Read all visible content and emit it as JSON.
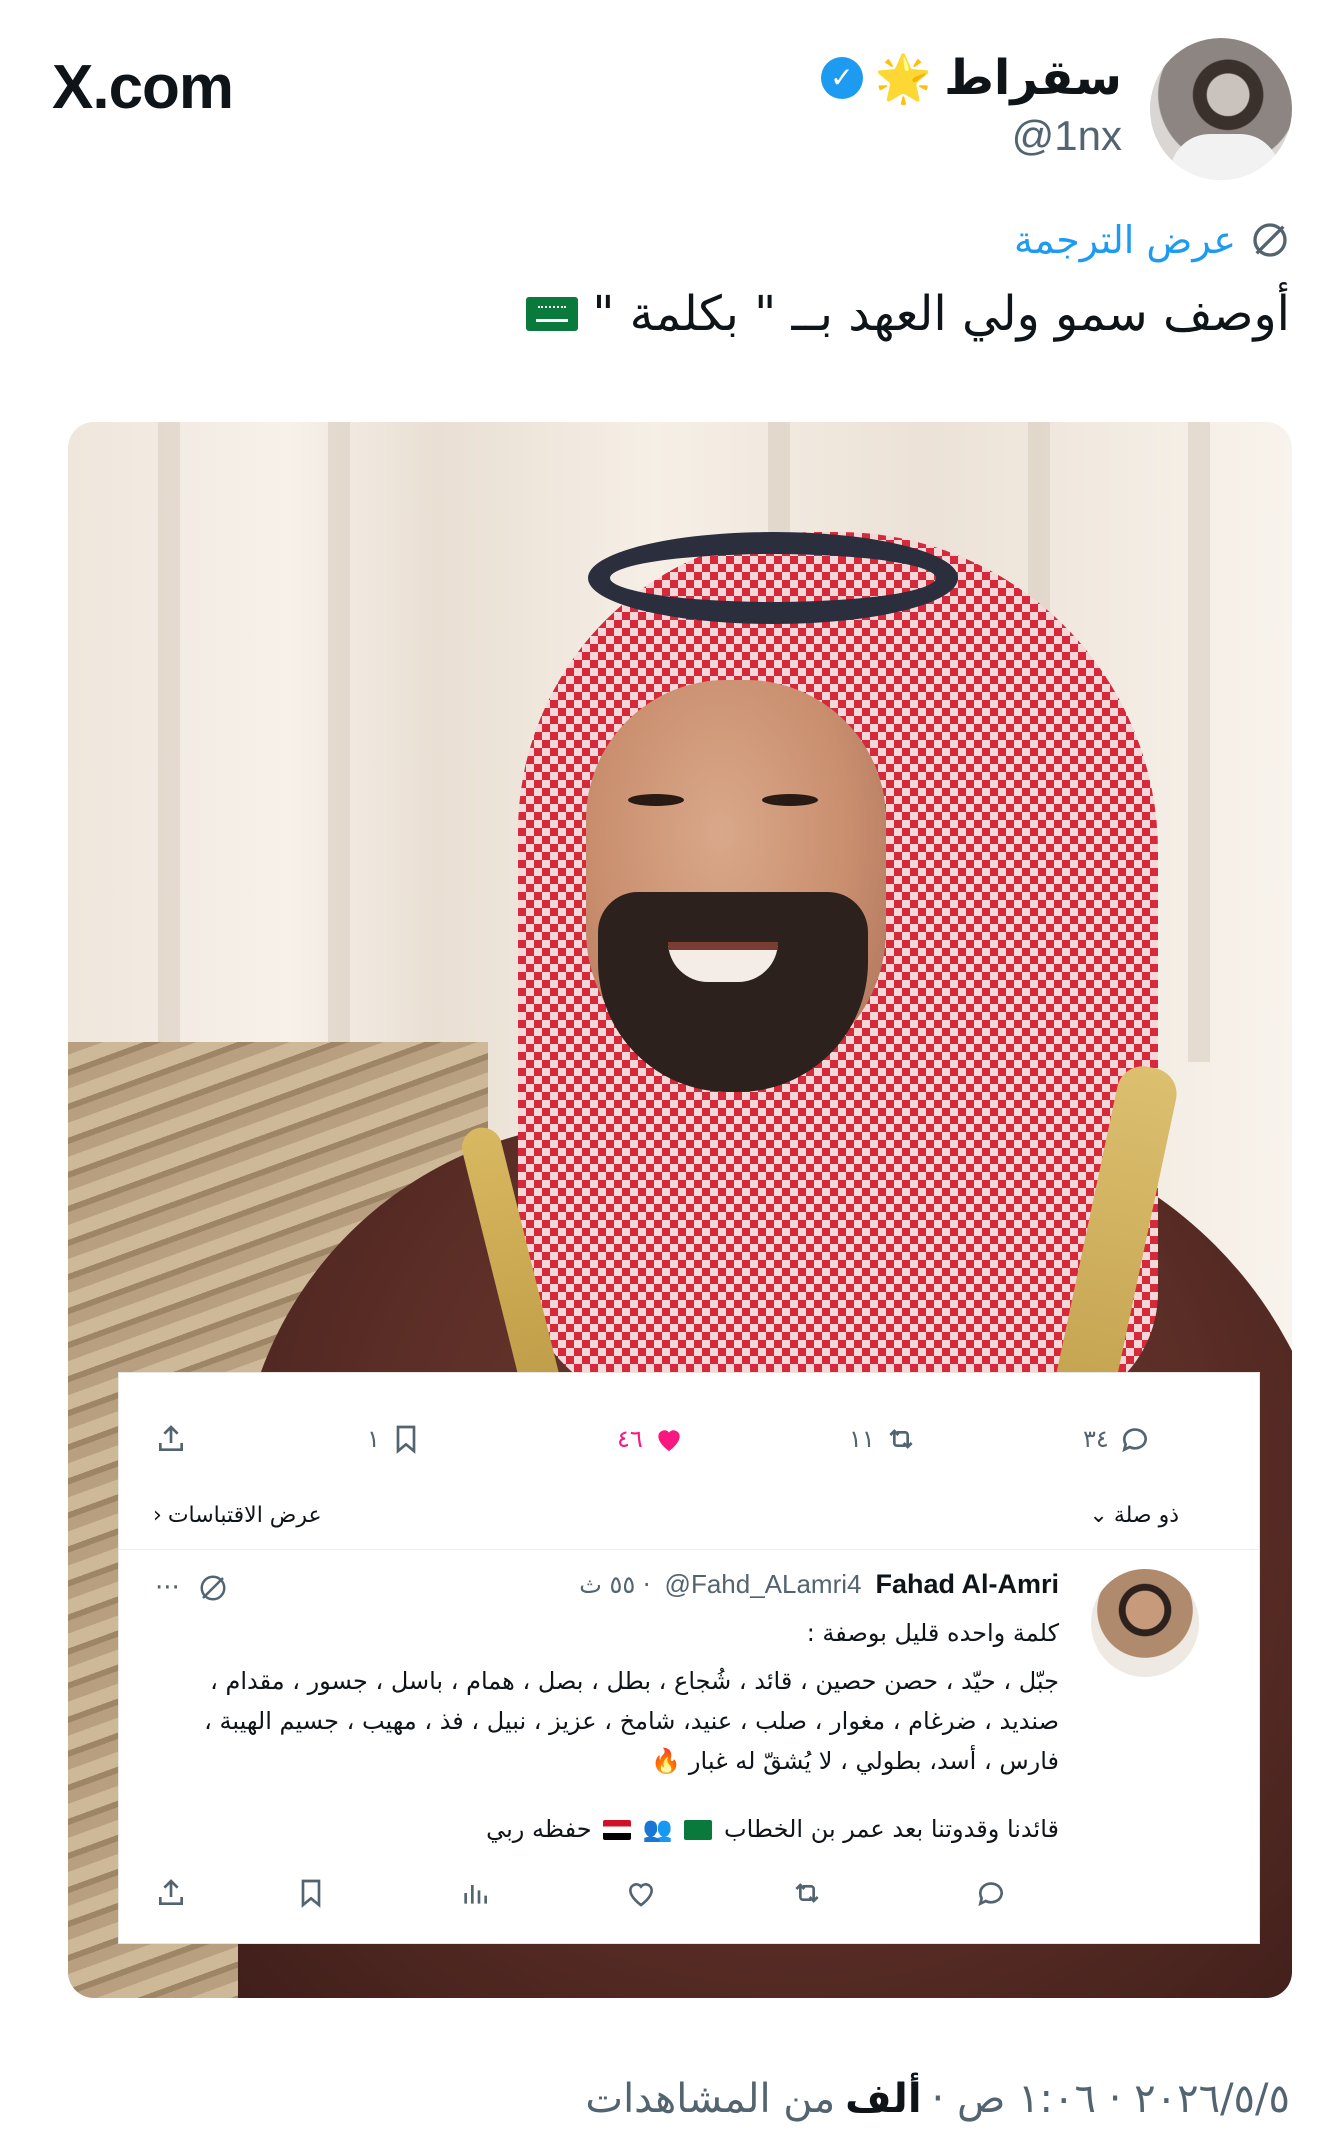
{
  "header": {
    "brand": "X.com",
    "display_name": "سقراط",
    "star_emoji": "🌟",
    "verified_mark": "✓",
    "handle": "@1nx"
  },
  "tweet": {
    "translate_label": "عرض الترجمة",
    "text": "أوصف سمو ولي العهد  بــ \" بكلمة \""
  },
  "quoted": {
    "top_actions": {
      "replies": "٣٤",
      "retweets": "١١",
      "likes": "٤٦",
      "bookmarks": "١"
    },
    "thread_label": "ذو صلة",
    "quotes_label": "عرض الاقتباسات",
    "author_name": "Fahad Al-Amri",
    "author_handle": "@Fahd_ALamri4",
    "time": "· ٥٥ ث",
    "more": "···",
    "lines": [
      "كلمة واحده قليل بوصفة :",
      "جبّل ، حيّد ، حصن حصين ، قائد ، شُجاع ، بطل ، بصل ، همام ، باسل ، جسور ، مقدام ،",
      "صنديد ، ضرغام ، مغوار ، صلب ، عنيد، شامخ ، عزيز ، نبيل ، فذ ، مهيب ، جسيم الهيبة ،",
      "فارس ، أسد، بطولي ، لا يُشقّ له غبار 🔥"
    ],
    "closing_line": "قائدنا وقدوتنا بعد عمر بن الخطاب",
    "closing_prayer": "حفظه ربي",
    "closing_emojis": "👥"
  },
  "footer": {
    "datetime": "٢٠٢٦/٥/٥ · ١:٠٦ ص ·",
    "views_bold": "ألف",
    "views_text": "من المشاهدات"
  },
  "colors": {
    "accent": "#1d9bf0",
    "like": "#f91880",
    "text": "#0f1419",
    "muted": "#536471"
  }
}
